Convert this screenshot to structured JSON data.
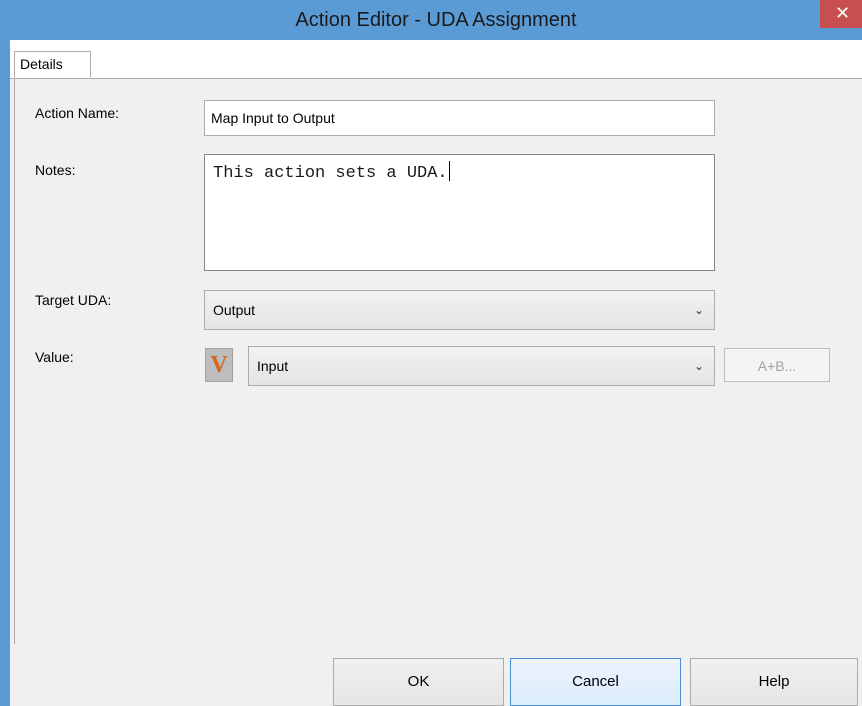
{
  "window": {
    "title": "Action Editor - UDA Assignment",
    "close_glyph": "✕"
  },
  "tabs": [
    {
      "label": "Details",
      "active": true
    }
  ],
  "form": {
    "action_name": {
      "label": "Action Name:",
      "value": "Map Input to Output"
    },
    "notes": {
      "label": "Notes:",
      "value": "This action sets a UDA."
    },
    "target_uda": {
      "label": "Target UDA:",
      "value": "Output",
      "chevron": "⌄"
    },
    "value": {
      "label": "Value:",
      "badge": "V",
      "selected": "Input",
      "chevron": "⌄",
      "expression_button": "A+B..."
    }
  },
  "buttons": {
    "ok": "OK",
    "cancel": "Cancel",
    "help": "Help"
  },
  "colors": {
    "titlebar": "#5b9bd5",
    "close": "#c74f4f",
    "badge_letter": "#d2691e"
  },
  "icons": {
    "close": "close-icon",
    "dropdown": "chevron-down-icon",
    "variable_badge": "variable-icon"
  }
}
